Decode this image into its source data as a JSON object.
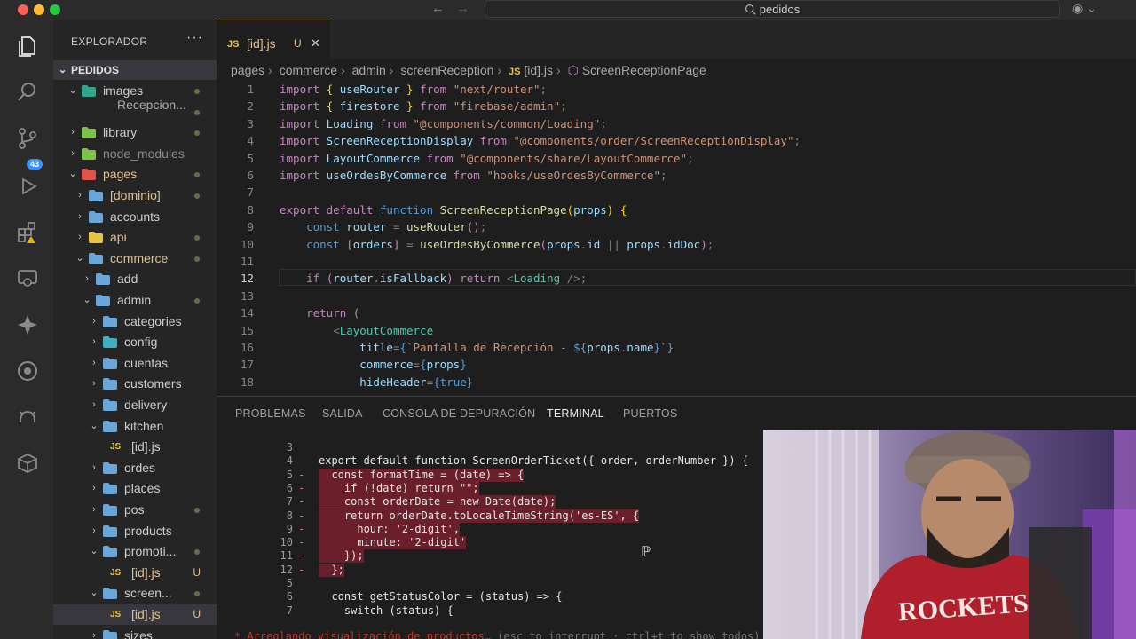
{
  "window": {
    "search_text": "pedidos",
    "colors": {
      "close": "#ff5f57",
      "minimize": "#febc2e",
      "maximize": "#28c840",
      "accent": "#3794ff",
      "modified": "#e2c08d"
    }
  },
  "activity_bar": {
    "icons": [
      "files-icon",
      "search-icon",
      "source-control-icon",
      "run-debug-icon",
      "extensions-icon",
      "remote-explorer-icon",
      "copilot-icon",
      "gitlens-icon",
      "github-icon",
      "docker-icon"
    ],
    "scm_badge": "43"
  },
  "explorer": {
    "title": "EXPLORADOR",
    "more": "···",
    "root": "PEDIDOS",
    "items": [
      {
        "label": "images",
        "indent": 1,
        "chevron": "v",
        "icon": "img-folder",
        "marker": "dot"
      },
      {
        "label": "Recepcion...",
        "indent": 3,
        "chevron": "",
        "icon": "none",
        "marker": "dot"
      },
      {
        "label": "library",
        "indent": 1,
        "chevron": ">",
        "icon": "green-folder",
        "marker": "dot"
      },
      {
        "label": "node_modules",
        "indent": 1,
        "chevron": ">",
        "icon": "green-folder",
        "marker": ""
      },
      {
        "label": "pages",
        "indent": 1,
        "chevron": "v",
        "icon": "red-folder",
        "marker": "dot"
      },
      {
        "label": "[dominio]",
        "indent": 2,
        "chevron": ">",
        "icon": "folder",
        "marker": "dot"
      },
      {
        "label": "accounts",
        "indent": 2,
        "chevron": ">",
        "icon": "folder",
        "marker": ""
      },
      {
        "label": "api",
        "indent": 2,
        "chevron": ">",
        "icon": "yellow-folder",
        "marker": "dot"
      },
      {
        "label": "commerce",
        "indent": 2,
        "chevron": "v",
        "icon": "folder",
        "marker": "dot"
      },
      {
        "label": "add",
        "indent": 3,
        "chevron": ">",
        "icon": "folder",
        "marker": ""
      },
      {
        "label": "admin",
        "indent": 3,
        "chevron": "v",
        "icon": "admin-folder",
        "marker": "dot"
      },
      {
        "label": "categories",
        "indent": 4,
        "chevron": ">",
        "icon": "folder",
        "marker": ""
      },
      {
        "label": "config",
        "indent": 4,
        "chevron": ">",
        "icon": "config-folder",
        "marker": ""
      },
      {
        "label": "cuentas",
        "indent": 4,
        "chevron": ">",
        "icon": "folder",
        "marker": ""
      },
      {
        "label": "customers",
        "indent": 4,
        "chevron": ">",
        "icon": "folder",
        "marker": ""
      },
      {
        "label": "delivery",
        "indent": 4,
        "chevron": ">",
        "icon": "folder",
        "marker": ""
      },
      {
        "label": "kitchen",
        "indent": 4,
        "chevron": "v",
        "icon": "folder",
        "marker": ""
      },
      {
        "label": "[id].js",
        "indent": 5,
        "chevron": "",
        "icon": "js",
        "marker": ""
      },
      {
        "label": "ordes",
        "indent": 4,
        "chevron": ">",
        "icon": "folder",
        "marker": ""
      },
      {
        "label": "places",
        "indent": 4,
        "chevron": ">",
        "icon": "folder",
        "marker": ""
      },
      {
        "label": "pos",
        "indent": 4,
        "chevron": ">",
        "icon": "folder",
        "marker": "dot"
      },
      {
        "label": "products",
        "indent": 4,
        "chevron": ">",
        "icon": "folder",
        "marker": ""
      },
      {
        "label": "promoti...",
        "indent": 4,
        "chevron": "v",
        "icon": "folder",
        "marker": "dot"
      },
      {
        "label": "[id].js",
        "indent": 5,
        "chevron": "",
        "icon": "js",
        "marker": "U"
      },
      {
        "label": "screen...",
        "indent": 4,
        "chevron": "v",
        "icon": "folder",
        "marker": "dot"
      },
      {
        "label": "[id].js",
        "indent": 5,
        "chevron": "",
        "icon": "js",
        "marker": "U",
        "selected": true
      },
      {
        "label": "sizes",
        "indent": 4,
        "chevron": ">",
        "icon": "folder",
        "marker": ""
      }
    ]
  },
  "tab": {
    "label": "[id].js",
    "status": "U",
    "close": "✕"
  },
  "breadcrumb": [
    "pages",
    "commerce",
    "admin",
    "screenReception",
    "[id].js",
    "ScreenReceptionPage"
  ],
  "editor": {
    "current_line": "12",
    "lines": [
      {
        "n": "1",
        "code": [
          [
            "kw",
            "import"
          ],
          [
            "pu",
            " "
          ],
          [
            "br",
            "{"
          ],
          [
            "pu",
            " "
          ],
          [
            "var",
            "useRouter"
          ],
          [
            "pu",
            " "
          ],
          [
            "br",
            "}"
          ],
          [
            "kw",
            " from "
          ],
          [
            "str",
            "\"next/router\""
          ],
          [
            "pu",
            ";"
          ]
        ]
      },
      {
        "n": "2",
        "code": [
          [
            "kw",
            "import"
          ],
          [
            "pu",
            " "
          ],
          [
            "br",
            "{"
          ],
          [
            "pu",
            " "
          ],
          [
            "var",
            "firestore"
          ],
          [
            "pu",
            " "
          ],
          [
            "br",
            "}"
          ],
          [
            "kw",
            " from "
          ],
          [
            "str",
            "\"firebase/admin\""
          ],
          [
            "pu",
            ";"
          ]
        ]
      },
      {
        "n": "3",
        "code": [
          [
            "kw",
            "import"
          ],
          [
            "var",
            " Loading"
          ],
          [
            "kw",
            " from "
          ],
          [
            "str",
            "\"@components/common/Loading\""
          ],
          [
            "pu",
            ";"
          ]
        ]
      },
      {
        "n": "4",
        "code": [
          [
            "kw",
            "import"
          ],
          [
            "var",
            " ScreenReceptionDisplay"
          ],
          [
            "kw",
            " from "
          ],
          [
            "str",
            "\"@components/order/ScreenReceptionDisplay\""
          ],
          [
            "pu",
            ";"
          ]
        ]
      },
      {
        "n": "5",
        "code": [
          [
            "kw",
            "import"
          ],
          [
            "var",
            " LayoutCommerce"
          ],
          [
            "kw",
            " from "
          ],
          [
            "str",
            "\"@components/share/LayoutCommerce\""
          ],
          [
            "pu",
            ";"
          ]
        ]
      },
      {
        "n": "6",
        "code": [
          [
            "kw",
            "import"
          ],
          [
            "var",
            " useOrdesByCommerce"
          ],
          [
            "kw",
            " from "
          ],
          [
            "str",
            "\"hooks/useOrdesByCommerce\""
          ],
          [
            "pu",
            ";"
          ]
        ]
      },
      {
        "n": "7",
        "code": []
      },
      {
        "n": "8",
        "code": [
          [
            "kw",
            "export default "
          ],
          [
            "kb",
            "function "
          ],
          [
            "fn",
            "ScreenReceptionPage"
          ],
          [
            "br",
            "("
          ],
          [
            "var",
            "props"
          ],
          [
            "br",
            ")"
          ],
          [
            "pu",
            " "
          ],
          [
            "br",
            "{"
          ]
        ]
      },
      {
        "n": "9",
        "code": [
          [
            "pu",
            "    "
          ],
          [
            "kb",
            "const "
          ],
          [
            "var",
            "router"
          ],
          [
            "pu",
            " = "
          ],
          [
            "fn",
            "useRouter"
          ],
          [
            "kw",
            "()"
          ],
          [
            "pu",
            ";"
          ]
        ]
      },
      {
        "n": "10",
        "code": [
          [
            "pu",
            "    "
          ],
          [
            "kb",
            "const "
          ],
          [
            "kw",
            "["
          ],
          [
            "var",
            "orders"
          ],
          [
            "kw",
            "]"
          ],
          [
            "pu",
            " = "
          ],
          [
            "fn",
            "useOrdesByCommerce"
          ],
          [
            "kw",
            "("
          ],
          [
            "var",
            "props"
          ],
          [
            "pu",
            "."
          ],
          [
            "var",
            "id"
          ],
          [
            "pu",
            " || "
          ],
          [
            "var",
            "props"
          ],
          [
            "pu",
            "."
          ],
          [
            "var",
            "idDoc"
          ],
          [
            "kw",
            ")"
          ],
          [
            "pu",
            ";"
          ]
        ]
      },
      {
        "n": "11",
        "code": []
      },
      {
        "n": "12",
        "code": [
          [
            "pu",
            "    "
          ],
          [
            "kw",
            "if "
          ],
          [
            "kw",
            "("
          ],
          [
            "var",
            "router"
          ],
          [
            "pu",
            "."
          ],
          [
            "var",
            "isFallback"
          ],
          [
            "kw",
            ")"
          ],
          [
            "kw",
            " return "
          ],
          [
            "pu",
            "<"
          ],
          [
            "tag",
            "Loading"
          ],
          [
            "pu",
            " />;"
          ]
        ]
      },
      {
        "n": "13",
        "code": []
      },
      {
        "n": "14",
        "code": [
          [
            "pu",
            "    "
          ],
          [
            "kw",
            "return "
          ],
          [
            "kw",
            "("
          ]
        ]
      },
      {
        "n": "15",
        "code": [
          [
            "pu",
            "        <"
          ],
          [
            "tag",
            "LayoutCommerce"
          ]
        ]
      },
      {
        "n": "16",
        "code": [
          [
            "var",
            "            title"
          ],
          [
            "pu",
            "="
          ],
          [
            "kb",
            "{"
          ],
          [
            "str",
            "`Pantalla de Recepción - "
          ],
          [
            "kb",
            "${"
          ],
          [
            "var",
            "props"
          ],
          [
            "pu",
            "."
          ],
          [
            "var",
            "name"
          ],
          [
            "kb",
            "}"
          ],
          [
            "str",
            "`"
          ],
          [
            "kb",
            "}"
          ]
        ]
      },
      {
        "n": "17",
        "code": [
          [
            "var",
            "            commerce"
          ],
          [
            "pu",
            "="
          ],
          [
            "kb",
            "{"
          ],
          [
            "var",
            "props"
          ],
          [
            "kb",
            "}"
          ]
        ]
      },
      {
        "n": "18",
        "code": [
          [
            "var",
            "            hideHeader"
          ],
          [
            "pu",
            "="
          ],
          [
            "kb",
            "{"
          ],
          [
            "kb",
            "true"
          ],
          [
            "kb",
            "}"
          ]
        ]
      }
    ]
  },
  "panel": {
    "tabs": [
      {
        "label": "PROBLEMAS",
        "active": false
      },
      {
        "label": "SALIDA",
        "active": false
      },
      {
        "label": "CONSOLA DE DEPURACIÓN",
        "active": false
      },
      {
        "label": "TERMINAL",
        "active": true
      },
      {
        "label": "PUERTOS",
        "active": false
      }
    ]
  },
  "terminal": {
    "lines": [
      {
        "n": "3",
        "minus": false,
        "code": "",
        "hl": false
      },
      {
        "n": "4",
        "minus": false,
        "code": "export default function ScreenOrderTicket({ order, orderNumber }) {",
        "hl": false
      },
      {
        "n": "5",
        "minus": true,
        "code": "  const formatTime = (date) => {",
        "hl": true
      },
      {
        "n": "6",
        "minus": true,
        "code": "    if (!date) return \"\";",
        "hl": true
      },
      {
        "n": "7",
        "minus": true,
        "code": "    const orderDate = new Date(date);",
        "hl": true
      },
      {
        "n": "8",
        "minus": true,
        "code": "    return orderDate.toLocaleTimeString('es-ES', {",
        "hl": true
      },
      {
        "n": "9",
        "minus": true,
        "code": "      hour: '2-digit',",
        "hl": true
      },
      {
        "n": "10",
        "minus": true,
        "code": "      minute: '2-digit'",
        "hl": true
      },
      {
        "n": "11",
        "minus": true,
        "code": "    });",
        "hl": true
      },
      {
        "n": "12",
        "minus": true,
        "code": "  };",
        "hl": true
      },
      {
        "n": "5",
        "minus": false,
        "code": "",
        "hl": false
      },
      {
        "n": "6",
        "minus": false,
        "code": "  const getStatusColor = (status) => {",
        "hl": false
      },
      {
        "n": "7",
        "minus": false,
        "code": "    switch (status) {",
        "hl": false
      }
    ],
    "status_text": "* Arreglando visualización de productos…",
    "status_hint": " (esc to interrupt · ctrl+t to show todos)"
  },
  "webcam": {
    "shirt_text": "ROCKETS"
  }
}
